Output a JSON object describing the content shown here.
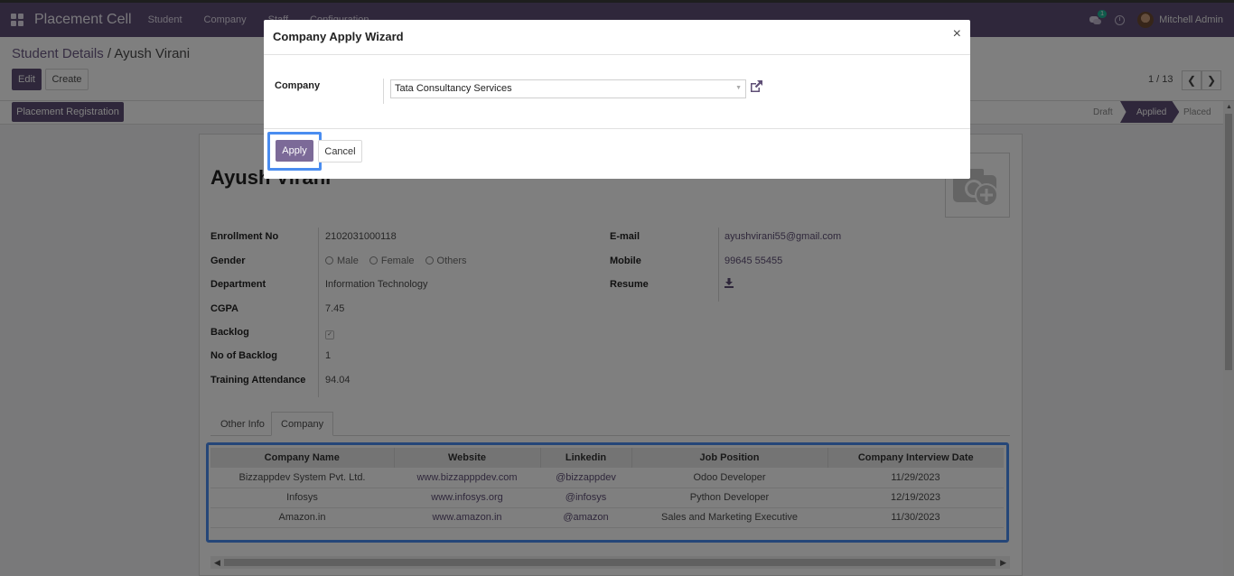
{
  "navbar": {
    "app_title": "Placement Cell",
    "menu": [
      "Student",
      "Company",
      "Staff",
      "Configuration"
    ],
    "chat_badge": "1",
    "user_name": "Mitchell Admin"
  },
  "control": {
    "breadcrumb_parent": "Student Details",
    "breadcrumb_sep": " / ",
    "breadcrumb_current": "Ayush Virani",
    "edit_label": "Edit",
    "create_label": "Create",
    "pager": "1 / 13",
    "placement_registration": "Placement Registration",
    "stages": [
      "Draft",
      "Applied",
      "Placed"
    ],
    "active_stage": "Applied"
  },
  "form": {
    "student_name": "Ayush Virani",
    "left": [
      {
        "label": "Enrollment No",
        "value": "2102031000118"
      },
      {
        "label": "Gender",
        "value": ""
      },
      {
        "label": "Department",
        "value": "Information Technology"
      },
      {
        "label": "CGPA",
        "value": "7.45"
      },
      {
        "label": "Backlog",
        "value": ""
      },
      {
        "label": "No of Backlog",
        "value": "1"
      },
      {
        "label": "Training Attendance",
        "value": "94.04"
      }
    ],
    "gender_options": [
      "Male",
      "Female",
      "Others"
    ],
    "right": [
      {
        "label": "E-mail",
        "value": "ayushvirani55@gmail.com"
      },
      {
        "label": "Mobile",
        "value": "99645 55455"
      },
      {
        "label": "Resume",
        "value": ""
      }
    ],
    "tabs": [
      "Other Info",
      "Company"
    ],
    "active_tab": "Company",
    "company_table": {
      "headers": [
        "Company Name",
        "Website",
        "Linkedin",
        "Job Position",
        "Company Interview Date"
      ],
      "rows": [
        [
          "Bizzappdev System Pvt. Ltd.",
          "www.bizzapppdev.com",
          "@bizzappdev",
          "Odoo Developer",
          "11/29/2023"
        ],
        [
          "Infosys",
          "www.infosys.org",
          "@infosys",
          "Python Developer",
          "12/19/2023"
        ],
        [
          "Amazon.in",
          "www.amazon.in",
          "@amazon",
          "Sales and Marketing Executive",
          "11/30/2023"
        ]
      ]
    }
  },
  "modal": {
    "title": "Company Apply Wizard",
    "close": "×",
    "company_label": "Company",
    "company_value": "Tata Consultancy Services",
    "apply_label": "Apply",
    "cancel_label": "Cancel"
  },
  "colors": {
    "brand": "#5f4f76",
    "highlight": "#4a8df0"
  }
}
